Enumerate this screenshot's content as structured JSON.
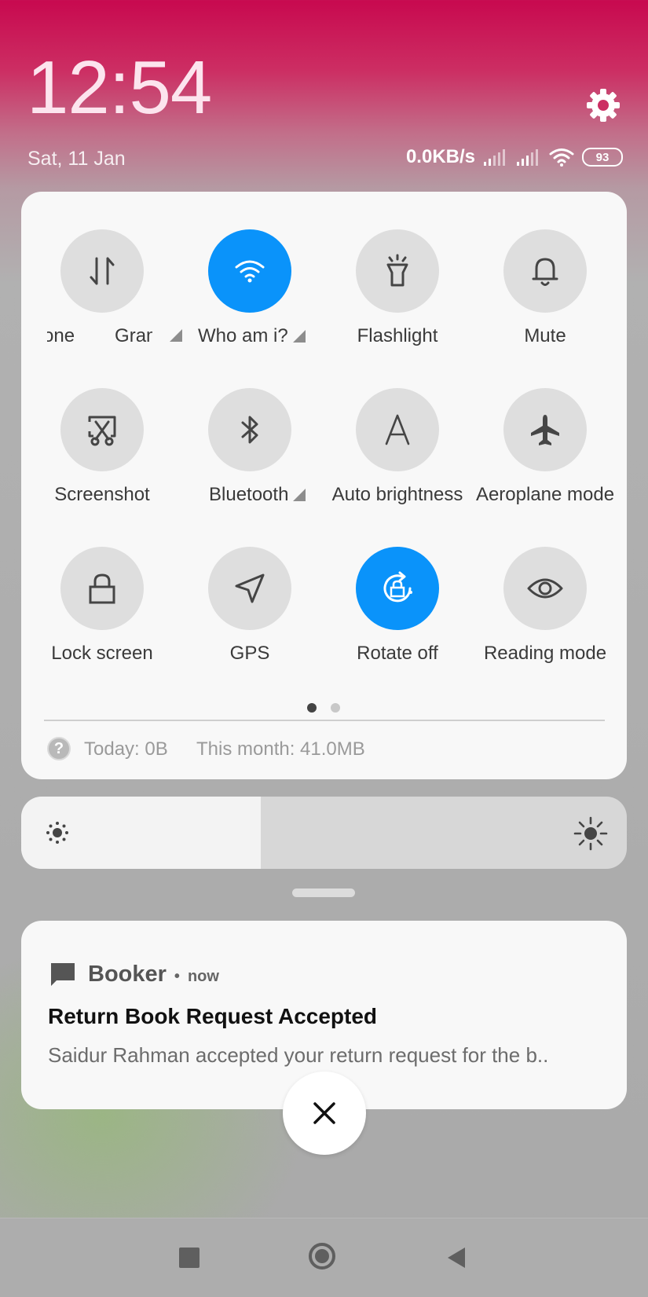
{
  "status_bar": {
    "time": "12:54",
    "date": "Sat, 11 Jan",
    "network_speed": "0.0KB/s",
    "battery": "93"
  },
  "quick_settings": {
    "tiles": [
      {
        "label_left": "one",
        "label": "Gram",
        "icon": "data-transfer-icon",
        "active": false
      },
      {
        "label": "Who am i?",
        "icon": "wifi-icon",
        "active": true
      },
      {
        "label": "Flashlight",
        "icon": "flashlight-icon",
        "active": false
      },
      {
        "label": "Mute",
        "icon": "bell-icon",
        "active": false
      },
      {
        "label": "Screenshot",
        "icon": "scissors-icon",
        "active": false
      },
      {
        "label": "Bluetooth",
        "icon": "bluetooth-icon",
        "active": false
      },
      {
        "label": "Auto brightness",
        "icon": "auto-brightness-icon",
        "active": false
      },
      {
        "label": "Aeroplane mode",
        "icon": "airplane-icon",
        "active": false
      },
      {
        "label": "Lock screen",
        "icon": "lock-icon",
        "active": false
      },
      {
        "label": "GPS",
        "icon": "location-arrow-icon",
        "active": false
      },
      {
        "label": "Rotate off",
        "icon": "rotation-lock-icon",
        "active": true
      },
      {
        "label": "Reading mode",
        "icon": "eye-icon",
        "active": false
      }
    ],
    "page_count": 2,
    "current_page": 1,
    "data_usage": {
      "today": "Today: 0B",
      "month": "This month: 41.0MB"
    }
  },
  "brightness": {
    "level": 0.395
  },
  "notification": {
    "app": "Booker",
    "separator": "•",
    "time": "now",
    "title": "Return Book Request Accepted",
    "body": "Saidur Rahman accepted your return request for the b.."
  },
  "colors": {
    "accent": "#0a93fa",
    "tile_inactive": "#dedede",
    "header_top": "#c8094f"
  }
}
